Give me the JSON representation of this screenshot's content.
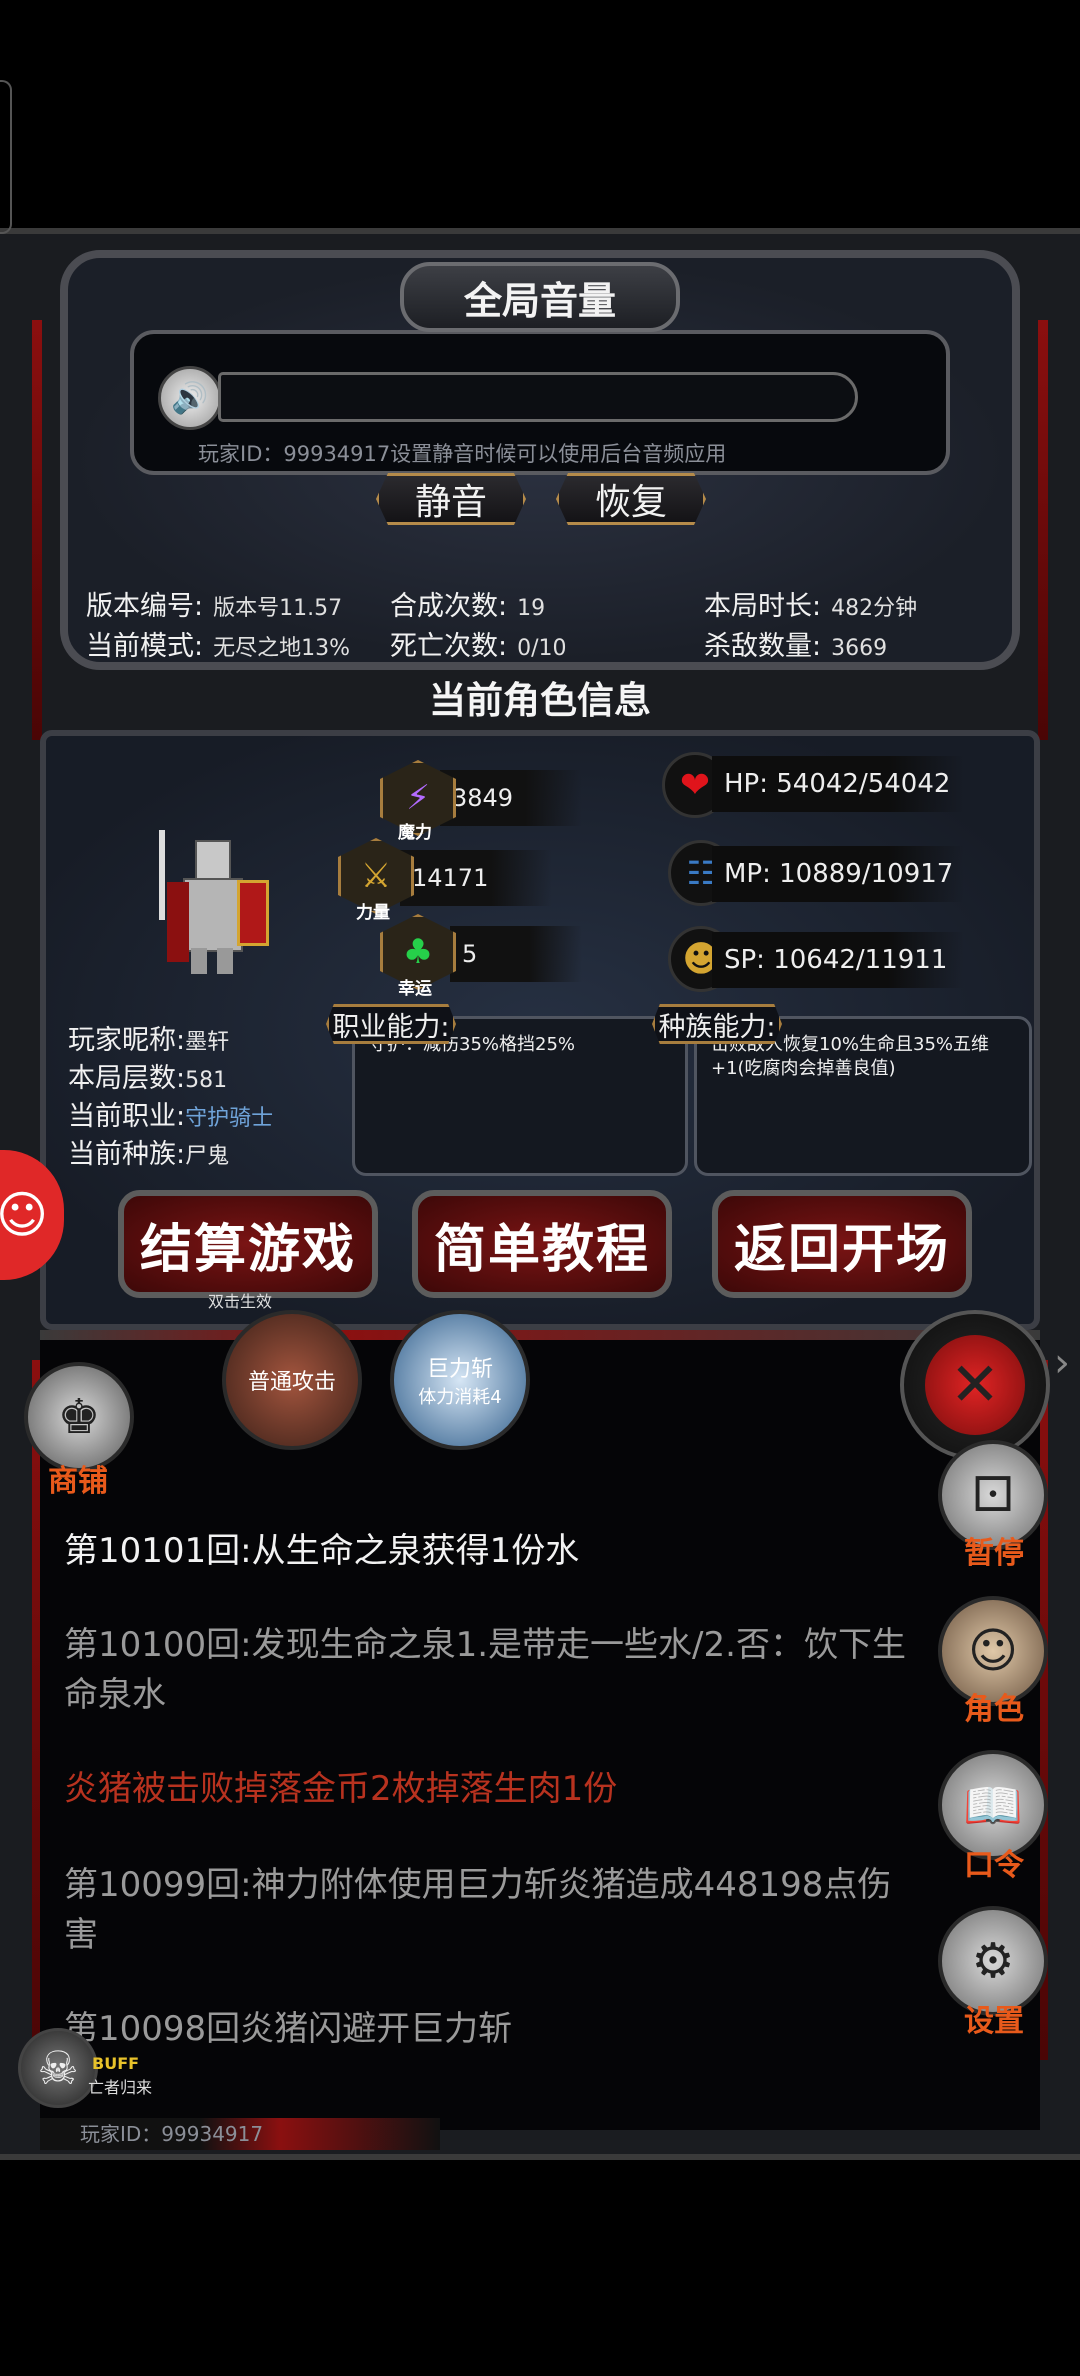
{
  "volume_panel": {
    "title": "全局音量",
    "hint": "玩家ID：99934917设置静音时候可以使用后台音频应用",
    "mute_label": "静音",
    "restore_label": "恢复"
  },
  "stats": {
    "version_label": "版本编号:",
    "version_value": "版本号11.57",
    "merge_label": "合成次数:",
    "merge_value": "19",
    "duration_label": "本局时长:",
    "duration_value": "482分钟",
    "mode_label": "当前模式:",
    "mode_value": "无尽之地13%",
    "death_label": "死亡次数:",
    "death_value": "0/10",
    "kills_label": "杀敌数量:",
    "kills_value": "3669"
  },
  "character": {
    "section_title": "当前角色信息",
    "attributes": [
      {
        "label": "魔力",
        "value": "3849",
        "icon": "lightning-icon"
      },
      {
        "label": "力量",
        "value": "14171",
        "icon": "sword-icon"
      },
      {
        "label": "幸运",
        "value": "5",
        "icon": "clover-icon"
      }
    ],
    "resources": {
      "hp": "HP:  54042/54042",
      "mp": "MP:  10889/10917",
      "sp": "SP:  10642/11911"
    },
    "nickname_label": "玩家昵称:",
    "nickname_value": "墨轩",
    "floor_label": "本局层数:",
    "floor_value": "581",
    "job_label": "当前职业:",
    "job_value": "守护骑士",
    "race_label": "当前种族:",
    "race_value": "尸鬼",
    "job_ability_label": "职业能力:",
    "job_ability_text": "守护：减伤35%格挡25%",
    "race_ability_label": "种族能力:",
    "race_ability_text": "击败敌人恢复10%生命且35%五维+1(吃腐肉会掉善良值)"
  },
  "actions": {
    "settle": "结算游戏",
    "settle_sub": "双击生效",
    "tutorial": "简单教程",
    "back": "返回开场"
  },
  "skills": {
    "normal_attack": "普通攻击",
    "heavy_slash": "巨力斩",
    "heavy_slash_cost": "体力消耗4"
  },
  "sidebar": {
    "shop": "商铺",
    "pause": "暂停",
    "role": "角色",
    "code": "口令",
    "settings": "设置"
  },
  "log": [
    {
      "text": "第10101回:从生命之泉获得1份水",
      "color": "#f2f2f2"
    },
    {
      "text": "第10100回:发现生命之泉1.是带走一些水/2.否：饮下生命泉水",
      "color": "#9a9a9a"
    },
    {
      "text": "炎猪被击败掉落金币2枚掉落生肉1份",
      "color": "#b8321f"
    },
    {
      "text": "第10099回:神力附体使用巨力斩炎猪造成448198点伤害",
      "color": "#9a9a9a"
    },
    {
      "text": "第10098回炎猪闪避开巨力斩",
      "color": "#9a9a9a"
    }
  ],
  "buff": {
    "label": "BUFF",
    "name": "亡者归来"
  },
  "footer": {
    "player_id": "玩家ID：99934917"
  }
}
